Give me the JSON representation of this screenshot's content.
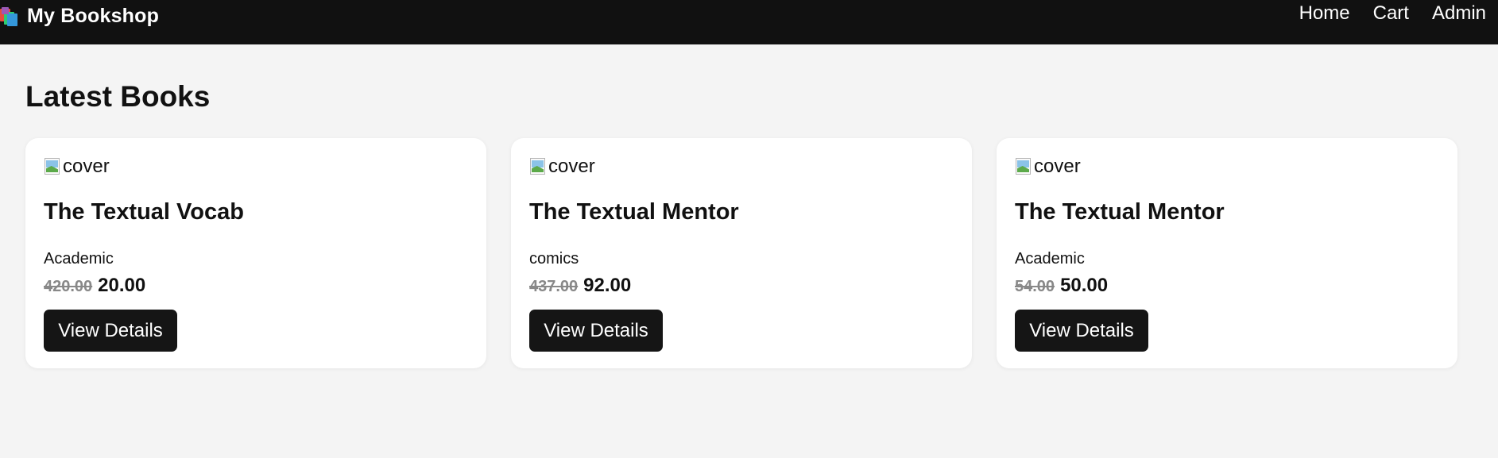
{
  "header": {
    "brand": "My Bookshop",
    "nav": [
      "Home",
      "Cart",
      "Admin"
    ]
  },
  "main": {
    "title": "Latest Books",
    "books": [
      {
        "cover_alt": "cover",
        "title": "The Textual Vocab",
        "category": "Academic",
        "old_price": "420.00",
        "price": "20.00",
        "button": "View Details"
      },
      {
        "cover_alt": "cover",
        "title": "The Textual Mentor",
        "category": "comics",
        "old_price": "437.00",
        "price": "92.00",
        "button": "View Details"
      },
      {
        "cover_alt": "cover",
        "title": "The Textual Mentor",
        "category": "Academic",
        "old_price": "54.00",
        "price": "50.00",
        "button": "View Details"
      }
    ]
  },
  "colors": {
    "topbar": "#111111",
    "background": "#f4f4f4",
    "card": "#ffffff",
    "button": "#151515",
    "old_price": "#888888"
  }
}
